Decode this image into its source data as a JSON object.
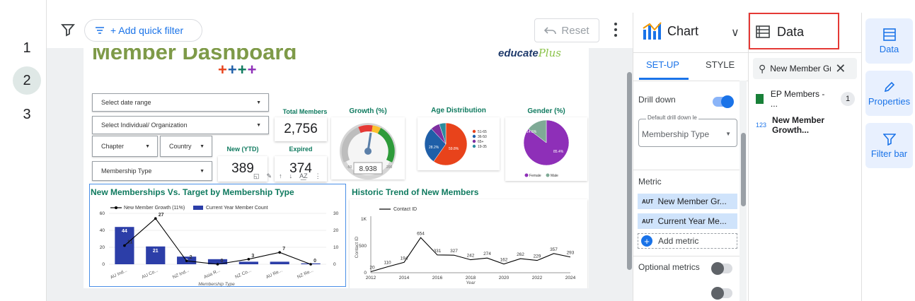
{
  "pages": [
    "1",
    "2",
    "3"
  ],
  "toolbar": {
    "quick_filter": "+ Add quick filter",
    "reset": "Reset"
  },
  "report": {
    "title": "Member Dashboard",
    "logo": "educate",
    "logo_suffix": "Plus",
    "controls": {
      "date_range": "Select date range",
      "individual": "Select Individual/ Organization",
      "chapter": "Chapter",
      "country": "Country",
      "membership_type": "Membership Type"
    },
    "kpis": {
      "total_members_label": "Total Members",
      "total_members": "2,756",
      "new_ytd_label": "New (YTD)",
      "new_ytd": "389",
      "expired_label": "Expired",
      "expired": "374"
    },
    "growth": {
      "title": "Growth (%)",
      "value": "8.938",
      "min": "-50",
      "max": "200"
    },
    "age": {
      "title": "Age Distribution",
      "slices": [
        {
          "label": "51-65",
          "value": 59.8,
          "color": "#e8431b"
        },
        {
          "label": "36-50",
          "value": 28.2,
          "color": "#1f5fa8"
        },
        {
          "label": "65+",
          "value": 7,
          "color": "#7d2fa0"
        },
        {
          "label": "19-35",
          "value": 5,
          "color": "#2b8c9e"
        }
      ],
      "labels_shown": [
        "28.2%",
        "59.8%"
      ]
    },
    "gender": {
      "title": "Gender (%)",
      "slices": [
        {
          "label": "Female",
          "value": 85.4,
          "color": "#8e2fb8"
        },
        {
          "label": "Male",
          "value": 14.6,
          "color": "#7faa96"
        }
      ],
      "labels_shown": [
        "14.6%",
        "85.4%"
      ]
    },
    "bar_chart_title": "New Memberships Vs. Target by Membership Type",
    "line_chart_title": "Historic Trend of New Members"
  },
  "chart_data": [
    {
      "type": "bar",
      "title": "New Memberships Vs. Target by Membership Type",
      "xlabel": "Membership Type",
      "categories": [
        "AU Ind...",
        "AU Co...",
        "NZ Ind...",
        "Asia R...",
        "NZ Co...",
        "AU Re...",
        "NZ Re..."
      ],
      "series": [
        {
          "name": "Current Year Member Count",
          "kind": "bar",
          "values": [
            44,
            21,
            9,
            6,
            3,
            3,
            1
          ],
          "labels": [
            "44",
            "21",
            "9",
            "",
            "",
            "",
            ""
          ]
        },
        {
          "name": "New Member Growth (11%)",
          "kind": "line",
          "values": [
            11,
            27,
            2,
            0,
            3,
            7,
            0
          ],
          "labels": [
            "11",
            "27",
            "2",
            "0",
            "3",
            "7",
            "0"
          ]
        }
      ],
      "ylim": [
        0,
        60
      ],
      "y_ticks": [
        "0",
        "20",
        "40",
        "60"
      ],
      "y2_ticks": [
        "0",
        "10",
        "20",
        "30"
      ]
    },
    {
      "type": "line",
      "title": "Historic Trend of New Members",
      "ylabel": "Contact ID",
      "xlabel": "Year",
      "series": [
        {
          "name": "Contact ID",
          "x": [
            2012,
            2013,
            2014,
            2015,
            2016,
            2017,
            2018,
            2019,
            2020,
            2021,
            2022,
            2023,
            2024
          ],
          "values": [
            20,
            110,
            194,
            654,
            331,
            327,
            242,
            274,
            162,
            262,
            229,
            357,
            293
          ]
        }
      ],
      "x_ticks": [
        "2012",
        "2014",
        "2016",
        "2018",
        "2020",
        "2022",
        "2024"
      ],
      "y_ticks": [
        "0",
        "500",
        "1K"
      ],
      "ylim": [
        0,
        1000
      ]
    }
  ],
  "chart_panel": {
    "title": "Chart",
    "tabs": [
      "SET-UP",
      "STYLE"
    ],
    "drill_down": "Drill down",
    "default_drill_label": "Default drill down le",
    "default_drill_value": "Membership Type",
    "metric_header": "Metric",
    "metrics": [
      {
        "badge": "AUT",
        "label": "New Member Gr..."
      },
      {
        "badge": "AUT",
        "label": "Current Year Me..."
      }
    ],
    "add_metric": "Add metric",
    "optional_metrics": "Optional metrics"
  },
  "data_panel": {
    "title": "Data",
    "search_value": "New Member Gr",
    "source": "EP Members - ...",
    "source_count": "1",
    "field_badge": "123",
    "field": "New Member Growth..."
  },
  "rail": [
    "Data",
    "Properties",
    "Filter bar"
  ],
  "colors": {
    "accent": "#1a73e8",
    "highlight": "#e53935",
    "title_green": "#0f7a5f",
    "bar_blue": "#2c3ea8"
  }
}
